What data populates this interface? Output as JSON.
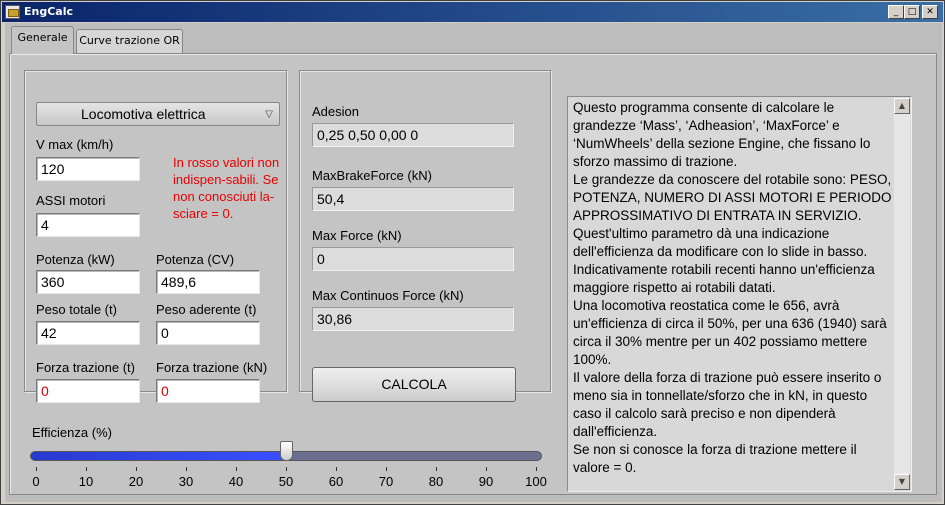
{
  "window": {
    "title": "EngCalc",
    "minimize": "_",
    "maximize": "□",
    "close": "✕"
  },
  "tabs": [
    {
      "label": "Generale"
    },
    {
      "label": "Curve trazione OR"
    }
  ],
  "left": {
    "type_select": {
      "value": "Locomotiva elettrica"
    },
    "vmax": {
      "label": "V max (km/h)",
      "value": "120"
    },
    "assi": {
      "label": "ASSI motori",
      "value": "4"
    },
    "note": "In rosso valori non indispen-sabili. Se non conosciuti la-sciare = 0.",
    "potenza_kw": {
      "label": "Potenza (kW)",
      "value": "360"
    },
    "potenza_cv": {
      "label": "Potenza (CV)",
      "value": "489,6"
    },
    "peso_totale": {
      "label": "Peso totale (t)",
      "value": "42"
    },
    "peso_aderente": {
      "label": "Peso aderente (t)",
      "value": "0"
    },
    "forza_t": {
      "label": "Forza trazione (t)",
      "value": "0"
    },
    "forza_kn": {
      "label": "Forza trazione (kN)",
      "value": "0"
    }
  },
  "middle": {
    "adesion": {
      "label": "Adesion",
      "value": "0,25  0,50  0,00  0"
    },
    "max_brake": {
      "label": "MaxBrakeForce (kN)",
      "value": "50,4"
    },
    "max_force": {
      "label": "Max Force (kN)",
      "value": "0"
    },
    "max_cont": {
      "label": "Max Continuos Force (kN)",
      "value": "30,86"
    },
    "calc_button": "CALCOLA"
  },
  "slider": {
    "label": "Efficienza (%)",
    "value": 50,
    "ticks": [
      "0",
      "10",
      "20",
      "30",
      "40",
      "50",
      "60",
      "70",
      "80",
      "90",
      "100"
    ]
  },
  "help": {
    "paragraphs": [
      "Questo programma consente di calcolare le grandezze ‘Mass’, ‘Adheasion’, ‘MaxForce’ e ‘NumWheels’ della sezione Engine, che fissano lo sforzo massimo di trazione.",
      "Le grandezze da conoscere del rotabile sono: PESO, POTENZA, NUMERO DI ASSI MOTORI E PERIODO APPROSSIMATIVO DI ENTRATA IN SERVIZIO.",
      "Quest'ultimo parametro dà una indicazione dell'efficienza da modificare con lo slide in basso.",
      "Indicativamente rotabili recenti hanno un'efficienza maggiore rispetto ai rotabili datati.",
      "Una locomotiva reostatica come le 656, avrà un'efficienza di circa il 50%, per una 636 (1940) sarà circa il 30% mentre per un 402 possiamo mettere 100%.",
      "Il valore della forza di trazione può essere inserito o meno sia in tonnellate/sforzo che in kN, in questo caso il calcolo sarà preciso e non dipenderà dall'efficienza.",
      "Se non si conosce la forza di trazione mettere il valore = 0."
    ]
  },
  "colors": {
    "optional_value": "#e00000",
    "slider_fill": "#3850ff"
  }
}
